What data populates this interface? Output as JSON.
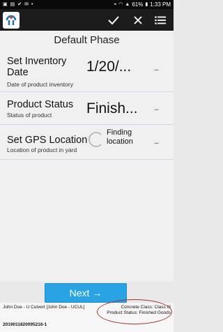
{
  "status_bar": {
    "battery": "61%",
    "time": "1:33 PM"
  },
  "app_bar": {
    "logo_icon": "app-logo-icon"
  },
  "page": {
    "title": "Default Phase"
  },
  "fields": [
    {
      "label": "Set Inventory Date",
      "label_line1": "Set Inventory",
      "label_line2": "Date",
      "description": "Date of product inventory",
      "value": "1/20/...",
      "more": "..."
    },
    {
      "label": "Product Status",
      "description": "Status of product",
      "value": "Finish...",
      "more": "..."
    },
    {
      "label": "Set GPS Location",
      "description": "Location of product in yard",
      "value_line1": "Finding",
      "value_line2": "location",
      "more": "..."
    }
  ],
  "next_button": {
    "label": "Next →"
  },
  "footer": {
    "user": "John Doe - U Culvert [John Doe - UCUL]",
    "concrete_class": "Concrete Class: Class III",
    "product_status": "Product Status: Finished Goods",
    "id": "2019011820095216-1"
  },
  "colors": {
    "accent": "#29a3e3",
    "app_bar": "#1c1c1c",
    "highlight": "#a3342c"
  }
}
